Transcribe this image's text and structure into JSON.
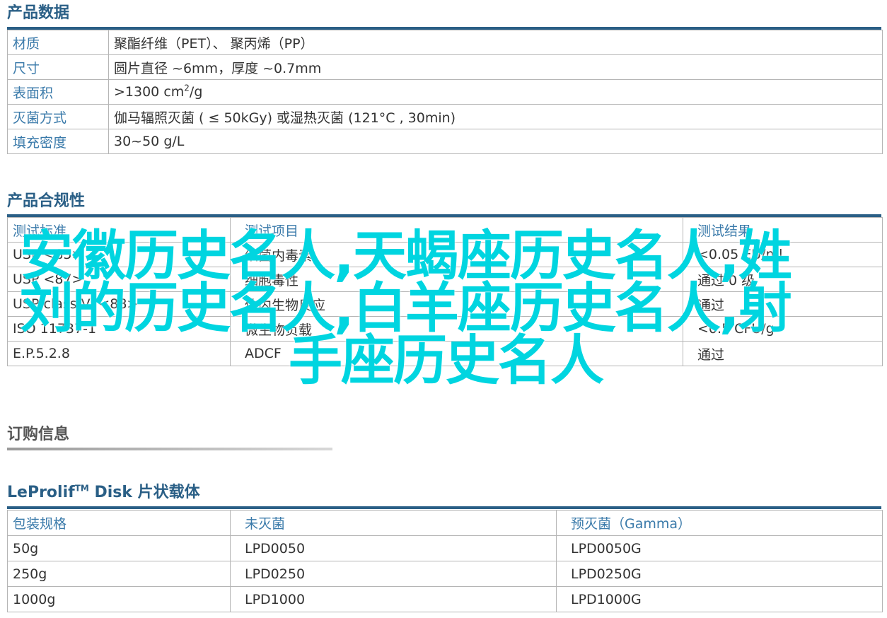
{
  "section1": {
    "title": "产品数据",
    "rows": [
      {
        "key": "材质",
        "value": "聚酯纤维（PET）、 聚丙烯（PP）"
      },
      {
        "key": "尺寸",
        "value": "圆片直径 ~6mm，厚度 ~0.7mm"
      },
      {
        "key": "表面积",
        "value_pre": ">1300 cm",
        "value_sup": "2",
        "value_post": "/g"
      },
      {
        "key": "灭菌方式",
        "value": "伽马辐照灭菌 ( ≤ 50kGy) 或湿热灭菌 (121°C , 30min)"
      },
      {
        "key": "填充密度",
        "value": "30~50 g/L"
      }
    ]
  },
  "section2": {
    "title": "产品合规性",
    "headers": [
      "测试标准",
      "测试项目",
      "测试结果"
    ],
    "rows": [
      [
        "USP <85>",
        "细菌内毒素",
        "<0.05 EU/ml"
      ],
      [
        "USP <87>",
        "细胞毒性",
        "通过 0 级"
      ],
      [
        "USP class VI <88>",
        "体内生物反应",
        "通过"
      ],
      [
        "ISO 11737-1",
        "微生物负载",
        "<0.5 CFU/g"
      ],
      [
        "E.P.5.2.8",
        "ADCF",
        "通过"
      ]
    ]
  },
  "section3": {
    "title": "订购信息"
  },
  "section4": {
    "title_pre": "LeProlif",
    "title_tm": "TM",
    "title_post": " Disk 片状载体",
    "headers": [
      "包装规格",
      "未灭菌",
      "预灭菌（Gamma）"
    ],
    "rows": [
      [
        "50g",
        "LPD0050",
        "LPD0050G"
      ],
      [
        "250g",
        "LPD0250",
        "LPD0250G"
      ],
      [
        "1000g",
        "LPD1000",
        "LPD1000G"
      ]
    ]
  },
  "overlay": {
    "line1": "安徽历史名人,天蝎座历史名人,姓",
    "line2": "刘的历史名人,白羊座历史名人,射",
    "line3": "手座历史名人"
  },
  "colors": {
    "heading": "#2a5f86",
    "key_text": "#3a7aaa",
    "overlay_text": "#00d5e0",
    "border": "#b5b5b5"
  }
}
